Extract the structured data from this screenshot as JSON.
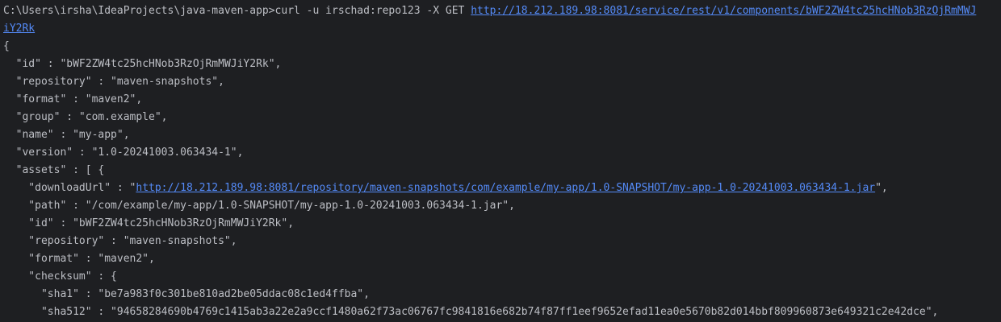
{
  "terminal": {
    "prompt": "C:\\Users\\irsha\\IdeaProjects\\java-maven-app>",
    "command": "curl -u irschad:repo123 -X GET ",
    "url_part1": "http://18.212.189.98:8081/service/rest/v1/components/bWF2ZW4tc25hcHNob3RzOjRmMWJ",
    "url_part2": "iY2Rk",
    "open_brace": "{",
    "id_prefix": "  \"id\" : ",
    "id_value": "\"bWF2ZW4tc25hcHNob3RzOjRmMWJiY2Rk\",",
    "repository_line": "  \"repository\" : \"maven-snapshots\",",
    "format_line": "  \"format\" : \"maven2\",",
    "group_line": "  \"group\" : \"com.example\",",
    "name_line": "  \"name\" : \"my-app\",",
    "version_line": "  \"version\" : \"1.0-20241003.063434-1\",",
    "assets_line": "  \"assets\" : [ {",
    "download_prefix": "    \"downloadUrl\" : \"",
    "download_url": "http://18.212.189.98:8081/repository/maven-snapshots/com/example/my-app/1.0-SNAPSHOT/my-app-1.0-20241003.063434-1.jar",
    "download_suffix": "\",",
    "path_line": "    \"path\" : \"/com/example/my-app/1.0-SNAPSHOT/my-app-1.0-20241003.063434-1.jar\",",
    "asset_id_line": "    \"id\" : \"bWF2ZW4tc25hcHNob3RzOjRmMWJiY2Rk\",",
    "asset_repository_line": "    \"repository\" : \"maven-snapshots\",",
    "asset_format_line": "    \"format\" : \"maven2\",",
    "checksum_line": "    \"checksum\" : {",
    "sha1_line": "      \"sha1\" : \"be7a983f0c301be810ad2be05ddac08c1ed4ffba\",",
    "sha512_line": "      \"sha512\" : \"94658284690b4769c1415ab3a22e2a9ccf1480a62f73ac06767fc9841816e682b74f87ff1eef9652efad11ea0e5670b82d014bbf809960873e649321c2e42dce\","
  }
}
